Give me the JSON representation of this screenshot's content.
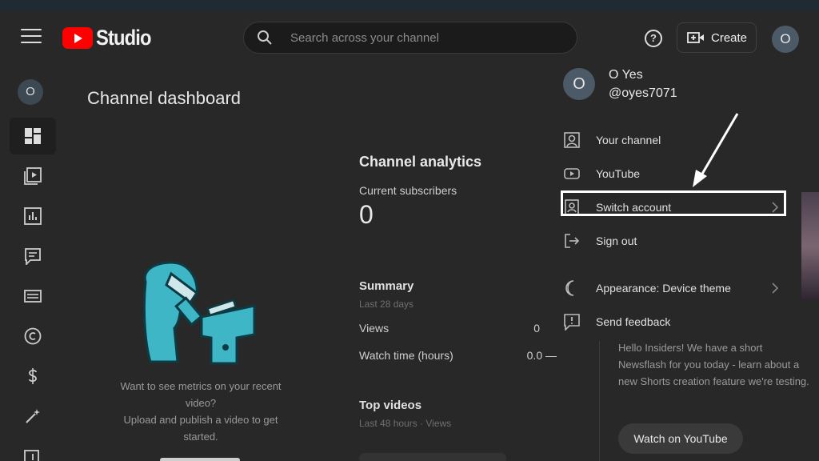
{
  "header": {
    "logo_text": "Studio",
    "search_placeholder": "Search across your channel",
    "help_glyph": "?",
    "create_label": "Create",
    "avatar_initial": "O"
  },
  "sidebar": {
    "avatar_initial": "O",
    "items": [
      {
        "icon": "dashboard-icon"
      },
      {
        "icon": "content-icon"
      },
      {
        "icon": "analytics-icon"
      },
      {
        "icon": "comments-icon"
      },
      {
        "icon": "subtitles-icon"
      },
      {
        "icon": "copyright-icon"
      },
      {
        "icon": "earn-icon"
      },
      {
        "icon": "customization-icon"
      },
      {
        "icon": "audio-library-icon"
      }
    ]
  },
  "main": {
    "title": "Channel dashboard",
    "empty_state": {
      "line1": "Want to see metrics on your recent video?",
      "line2": "Upload and publish a video to get started."
    }
  },
  "analytics": {
    "title": "Channel analytics",
    "subs_label": "Current subscribers",
    "subs_count": "0",
    "summary_title": "Summary",
    "summary_range": "Last 28 days",
    "metrics": [
      {
        "label": "Views",
        "value": "0"
      },
      {
        "label": "Watch time (hours)",
        "value": "0.0 —"
      }
    ],
    "top_videos_title": "Top videos",
    "top_videos_range": "Last 48 hours · Views"
  },
  "news": {
    "text": "Hello Insiders! We have a short Newsflash for you today - learn about a new Shorts creation feature we're testing.",
    "button": "Watch on YouTube"
  },
  "account_menu": {
    "avatar_initial": "O",
    "name": "O Yes",
    "handle": "@oyes7071",
    "items": [
      {
        "label": "Your channel",
        "icon": "channel-icon"
      },
      {
        "label": "YouTube",
        "icon": "youtube-icon"
      },
      {
        "label": "Switch account",
        "icon": "switch-account-icon",
        "has_submenu": true
      },
      {
        "label": "Sign out",
        "icon": "sign-out-icon"
      },
      {
        "label": "Appearance: Device theme",
        "icon": "appearance-icon",
        "has_submenu": true
      },
      {
        "label": "Send feedback",
        "icon": "feedback-icon"
      }
    ]
  },
  "colors": {
    "background": "#282828",
    "brand_red": "#ff0000",
    "illustration": "#3fb6c6"
  }
}
